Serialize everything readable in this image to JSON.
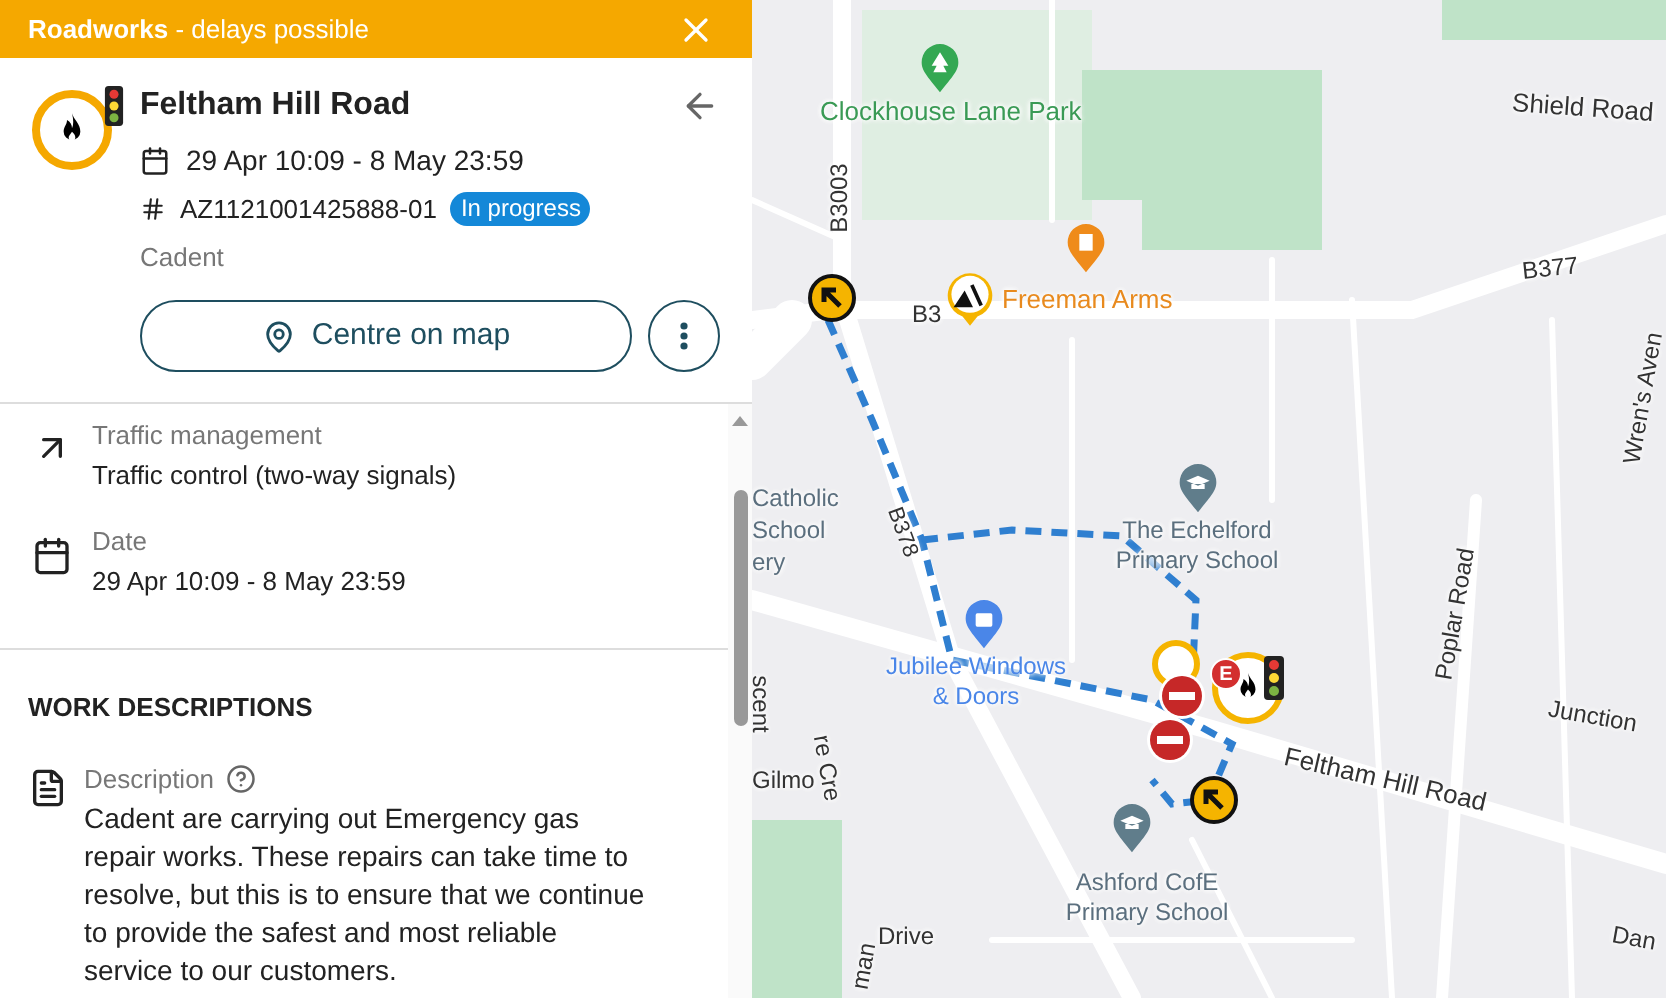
{
  "banner": {
    "text": "**Roadworks** - delays possible"
  },
  "work": {
    "title": "Feltham Hill Road",
    "date": "29 Apr 10:09 - 8 May 23:59",
    "reference": "AZ1121001425888-01",
    "status": "In progress",
    "operator": "Cadent"
  },
  "actions": [
    {
      "kind": "centre",
      "label": "Centre on map"
    },
    {
      "kind": "more"
    }
  ],
  "details": [
    {
      "kind": "traffic",
      "label": "Traffic management",
      "value": "Traffic control (two-way signals)"
    },
    {
      "kind": "date",
      "label": "Date",
      "value": "29 Apr 10:09 - 8 May 23:59"
    }
  ],
  "section": {
    "title": "WORK DESCRIPTIONS",
    "items": [
      {
        "kind": "description",
        "label": "Description",
        "value": "Cadent are carrying out Emergency gas repair works. These repairs can take time to resolve, but this is to ensure that we continue to provide the safest and most reliable service to our customers."
      }
    ]
  },
  "map": {
    "labels": [
      {
        "kind": "park",
        "text": "Clockhouse Lane Park"
      },
      {
        "kind": "road",
        "text": "Shield Road"
      },
      {
        "kind": "road",
        "text": "B3003"
      },
      {
        "kind": "road",
        "text": "B3"
      },
      {
        "kind": "food",
        "text": "Freeman Arms"
      },
      {
        "kind": "road",
        "text": "B377"
      },
      {
        "kind": "road",
        "text": "Wren's Aven"
      },
      {
        "kind": "school",
        "text": "Catholic"
      },
      {
        "kind": "school",
        "text": "School"
      },
      {
        "kind": "school",
        "text": "ery"
      },
      {
        "kind": "road",
        "text": "B378"
      },
      {
        "kind": "school",
        "text": "The Echelford Primary School"
      },
      {
        "kind": "shop",
        "text": "Jubilee Windows & Doors"
      },
      {
        "kind": "road",
        "text": "Poplar Road"
      },
      {
        "kind": "road",
        "text": "Junction"
      },
      {
        "kind": "road",
        "text": "Feltham Hill Road"
      },
      {
        "kind": "road",
        "text": "Gilmo"
      },
      {
        "kind": "road",
        "text": "re Cre"
      },
      {
        "kind": "road",
        "text": "scent"
      },
      {
        "kind": "school",
        "text": "Ashford CofE Primary School"
      },
      {
        "kind": "road",
        "text": "Drive"
      },
      {
        "kind": "road",
        "text": "man"
      },
      {
        "kind": "road",
        "text": "Dan"
      }
    ],
    "badge": "E"
  }
}
